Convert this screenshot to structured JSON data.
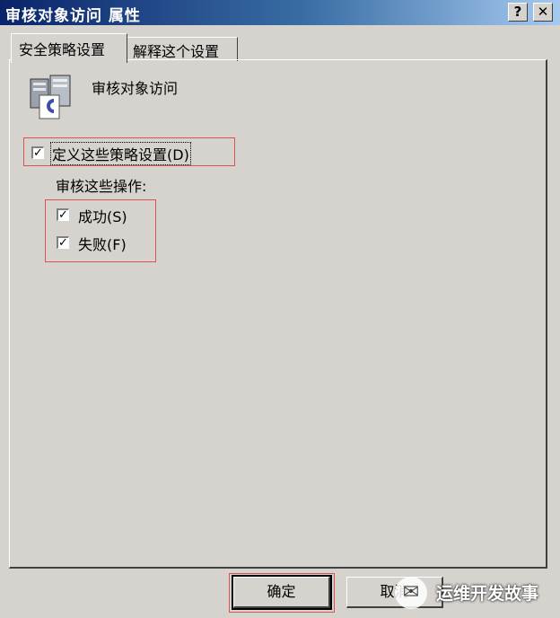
{
  "window": {
    "title": "审核对象访问 属性",
    "help_label": "?",
    "close_label": "✕"
  },
  "tabs": [
    {
      "label": "安全策略设置",
      "active": true
    },
    {
      "label": "解释这个设置",
      "active": false
    }
  ],
  "policy": {
    "icon": "server-policy-icon",
    "name": "审核对象访问"
  },
  "define_setting": {
    "label": "定义这些策略设置(D)",
    "checked": true
  },
  "audit_ops": {
    "heading": "审核这些操作:",
    "options": [
      {
        "label": "成功(S)",
        "checked": true
      },
      {
        "label": "失败(F)",
        "checked": true
      }
    ]
  },
  "buttons": {
    "ok": "确定",
    "cancel": "取消"
  },
  "watermark": {
    "text": "运维开发故事"
  },
  "colors": {
    "highlight": "#d9534f",
    "titlebar": "#0a246a",
    "face": "#d6d3ce"
  }
}
